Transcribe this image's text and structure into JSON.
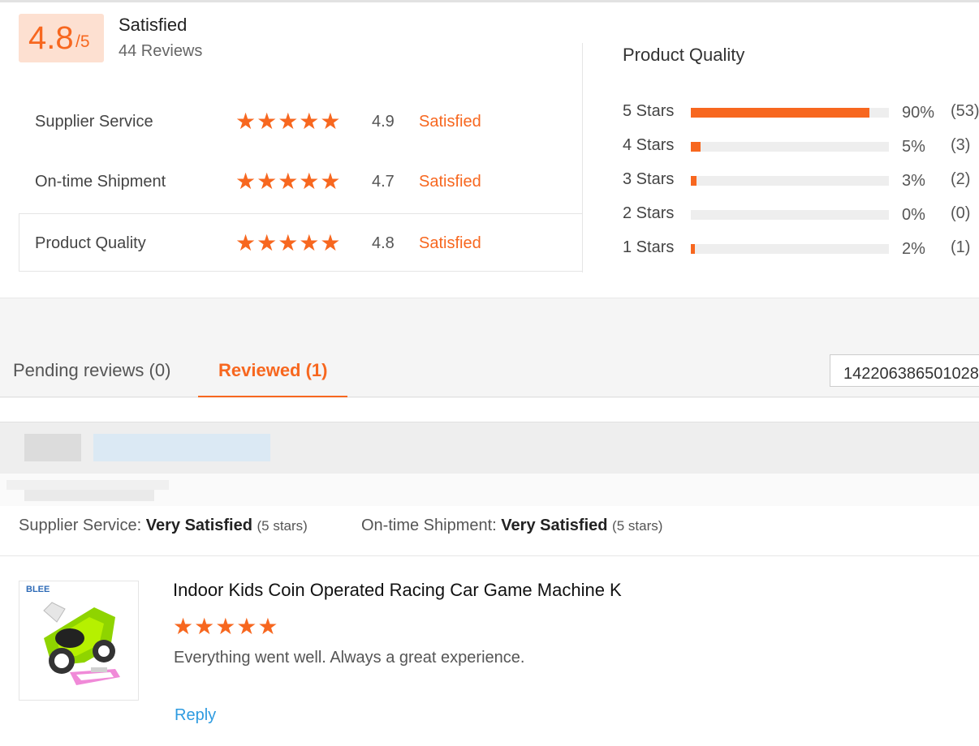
{
  "summary": {
    "score": "4.8",
    "score_suffix": "/5",
    "label": "Satisfied",
    "reviews": "44 Reviews"
  },
  "metrics": [
    {
      "label": "Supplier Service",
      "stars": "★★★★★",
      "score": "4.9",
      "status": "Satisfied"
    },
    {
      "label": "On-time Shipment",
      "stars": "★★★★★",
      "score": "4.7",
      "status": "Satisfied"
    },
    {
      "label": "Product Quality",
      "stars": "★★★★★",
      "score": "4.8",
      "status": "Satisfied"
    }
  ],
  "quality": {
    "title": "Product Quality",
    "rows": [
      {
        "label": "5 Stars",
        "pct": "90%",
        "count": "(53)",
        "fill": 0.9
      },
      {
        "label": "4 Stars",
        "pct": "5%",
        "count": "(3)",
        "fill": 0.05
      },
      {
        "label": "3 Stars",
        "pct": "3%",
        "count": "(2)",
        "fill": 0.03
      },
      {
        "label": "2 Stars",
        "pct": "0%",
        "count": "(0)",
        "fill": 0
      },
      {
        "label": "1 Stars",
        "pct": "2%",
        "count": "(1)",
        "fill": 0.02
      }
    ]
  },
  "tabs": {
    "pending": "Pending reviews (0)",
    "reviewed": "Reviewed (1)"
  },
  "search": {
    "value": "142206386501028"
  },
  "review": {
    "supplier_label": "Supplier Service:",
    "supplier_value": "Very Satisfied",
    "supplier_stars": "(5 stars)",
    "shipment_label": "On-time Shipment:",
    "shipment_value": "Very Satisfied",
    "shipment_stars": "(5 stars)",
    "product_title": "Indoor Kids Coin Operated Racing Car Game Machine K",
    "product_brand": "BLEE",
    "stars": "★★★★★",
    "text": "Everything went well. Always a great experience.",
    "reply": "Reply"
  },
  "colors": {
    "accent": "#f7671f",
    "link": "#2e9be0",
    "score_bg": "#fde0d1"
  }
}
